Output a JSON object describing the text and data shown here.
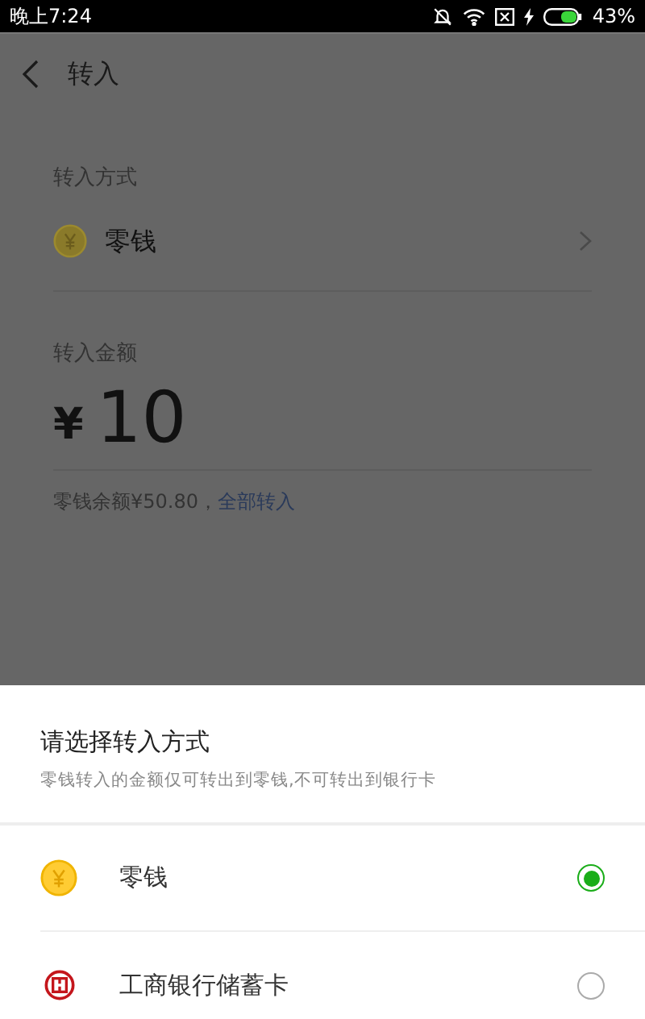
{
  "status_bar": {
    "time": "晚上7:24",
    "battery": "43%"
  },
  "header": {
    "title": "转入"
  },
  "method": {
    "label": "转入方式",
    "value": "零钱"
  },
  "amount": {
    "label": "转入金额",
    "currency": "¥",
    "value": "10",
    "balance": "零钱余额¥50.80，",
    "link": "全部转入"
  },
  "sheet": {
    "title": "请选择转入方式",
    "note": "零钱转入的金额仅可转出到零钱,不可转出到银行卡",
    "options": [
      {
        "kind": "coin",
        "label": "零钱",
        "selected": true
      },
      {
        "kind": "bank",
        "label": "工商银行储蓄卡",
        "selected": false
      }
    ]
  }
}
